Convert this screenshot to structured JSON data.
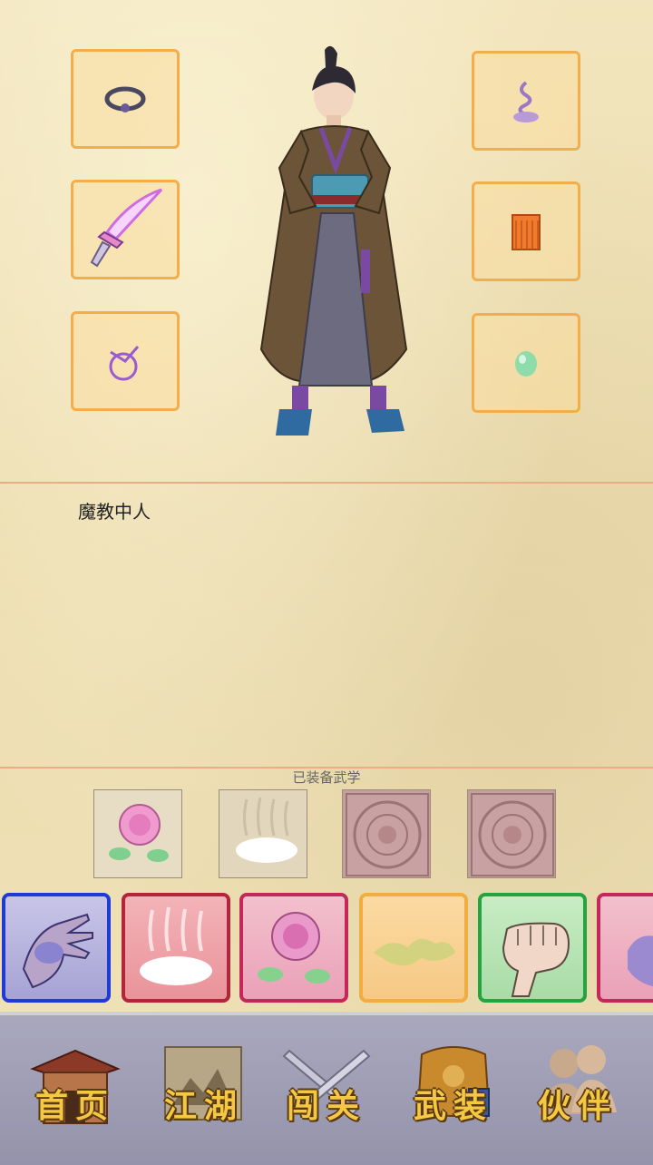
{
  "character": {
    "description": "魔教中人",
    "equip_slots_left": [
      "ring",
      "saber",
      "belt-charm"
    ],
    "equip_slots_right": [
      "hairpin",
      "armor-skirt",
      "jade"
    ]
  },
  "equipped": {
    "title": "已装备武学",
    "items": [
      {
        "icon": "rose-art"
      },
      {
        "icon": "mist-art"
      },
      {
        "icon": "locked-seal"
      },
      {
        "icon": "locked-seal"
      }
    ]
  },
  "skills": [
    {
      "icon": "palm-art",
      "border": "#1f3ad6"
    },
    {
      "icon": "mist-art",
      "border": "#b2253a"
    },
    {
      "icon": "rose-art",
      "border": "#c4275a"
    },
    {
      "icon": "leaf-art",
      "border": "#f1ad42"
    },
    {
      "icon": "fist-art",
      "border": "#21a53c"
    },
    {
      "icon": "hand-art",
      "border": "#c4275a"
    }
  ],
  "nav": {
    "home": "首页",
    "jianghu": "江湖",
    "challenge": "闯关",
    "gear": "武装",
    "partner": "伙伴"
  }
}
